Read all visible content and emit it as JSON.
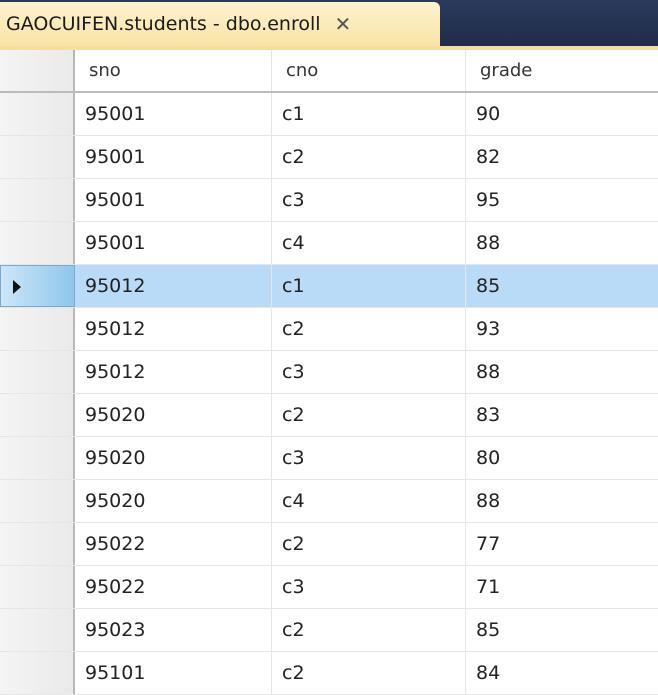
{
  "tab": {
    "title": "GAOCUIFEN.students - dbo.enroll",
    "close": "✕"
  },
  "columns": [
    "sno",
    "cno",
    "grade"
  ],
  "selected_row": 4,
  "rows": [
    [
      "95001",
      "c1",
      "90"
    ],
    [
      "95001",
      "c2",
      "82"
    ],
    [
      "95001",
      "c3",
      "95"
    ],
    [
      "95001",
      "c4",
      "88"
    ],
    [
      "95012",
      "c1",
      "85"
    ],
    [
      "95012",
      "c2",
      "93"
    ],
    [
      "95012",
      "c3",
      "88"
    ],
    [
      "95020",
      "c2",
      "83"
    ],
    [
      "95020",
      "c3",
      "80"
    ],
    [
      "95020",
      "c4",
      "88"
    ],
    [
      "95022",
      "c2",
      "77"
    ],
    [
      "95022",
      "c3",
      "71"
    ],
    [
      "95023",
      "c2",
      "85"
    ],
    [
      "95101",
      "c2",
      "84"
    ]
  ]
}
